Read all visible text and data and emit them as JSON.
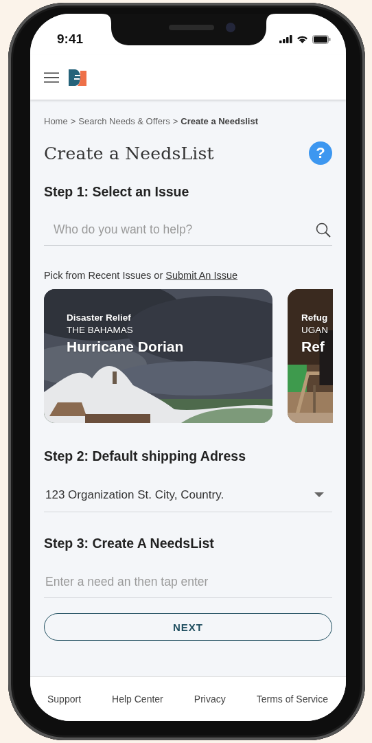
{
  "status_bar": {
    "time": "9:41"
  },
  "breadcrumb": [
    {
      "label": "Home",
      "kind": "link"
    },
    {
      "label": ">",
      "kind": "separator"
    },
    {
      "label": "Search Needs & Offers",
      "kind": "link"
    },
    {
      "label": ">",
      "kind": "separator"
    },
    {
      "label": "Create a Needslist",
      "kind": "current"
    }
  ],
  "page_title": "Create a NeedsList",
  "help_button": "?",
  "step_1": {
    "title": "Step 1: Select an Issue",
    "search": {
      "placeholder": "Who do you want to help?"
    },
    "pick_text": "Pick from Recent Issues or",
    "pick_link": "Submit An Issue",
    "issues": [
      {
        "category": "Disaster Relief",
        "location": "THE BAHAMAS",
        "title": "Hurricane Dorian"
      },
      {
        "category": "Refug",
        "location": "UGAN",
        "title": "Ref"
      }
    ]
  },
  "step_2": {
    "title": "Step 2: Default shipping Adress",
    "address": "123 Organization St. City, Country."
  },
  "step_3": {
    "title": "Step 3: Create A NeedsList",
    "input": {
      "placeholder": "Enter a need an then tap enter"
    }
  },
  "next_button": "NEXT",
  "footer": [
    "Support",
    "Help Center",
    "Privacy",
    "Terms of Service"
  ]
}
